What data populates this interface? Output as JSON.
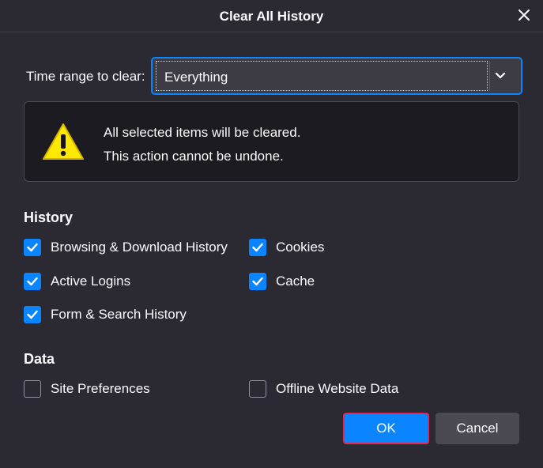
{
  "window": {
    "title": "Clear All History",
    "close_icon": "close-icon"
  },
  "time_range": {
    "label": "Time range to clear:",
    "selected": "Everything"
  },
  "warning": {
    "icon": "warning-icon",
    "line1": "All selected items will be cleared.",
    "line2": "This action cannot be undone."
  },
  "history": {
    "heading": "History",
    "items": [
      {
        "label": "Browsing & Download History",
        "checked": true
      },
      {
        "label": "Cookies",
        "checked": true
      },
      {
        "label": "Active Logins",
        "checked": true
      },
      {
        "label": "Cache",
        "checked": true
      },
      {
        "label": "Form & Search History",
        "checked": true
      }
    ]
  },
  "data_section": {
    "heading": "Data",
    "items": [
      {
        "label": "Site Preferences",
        "checked": false
      },
      {
        "label": "Offline Website Data",
        "checked": false
      }
    ]
  },
  "buttons": {
    "ok": "OK",
    "cancel": "Cancel"
  },
  "colors": {
    "background": "#2b2a33",
    "accent": "#0a84ff",
    "warning_yellow": "#ffe900",
    "ok_focus_border": "#e22850"
  }
}
